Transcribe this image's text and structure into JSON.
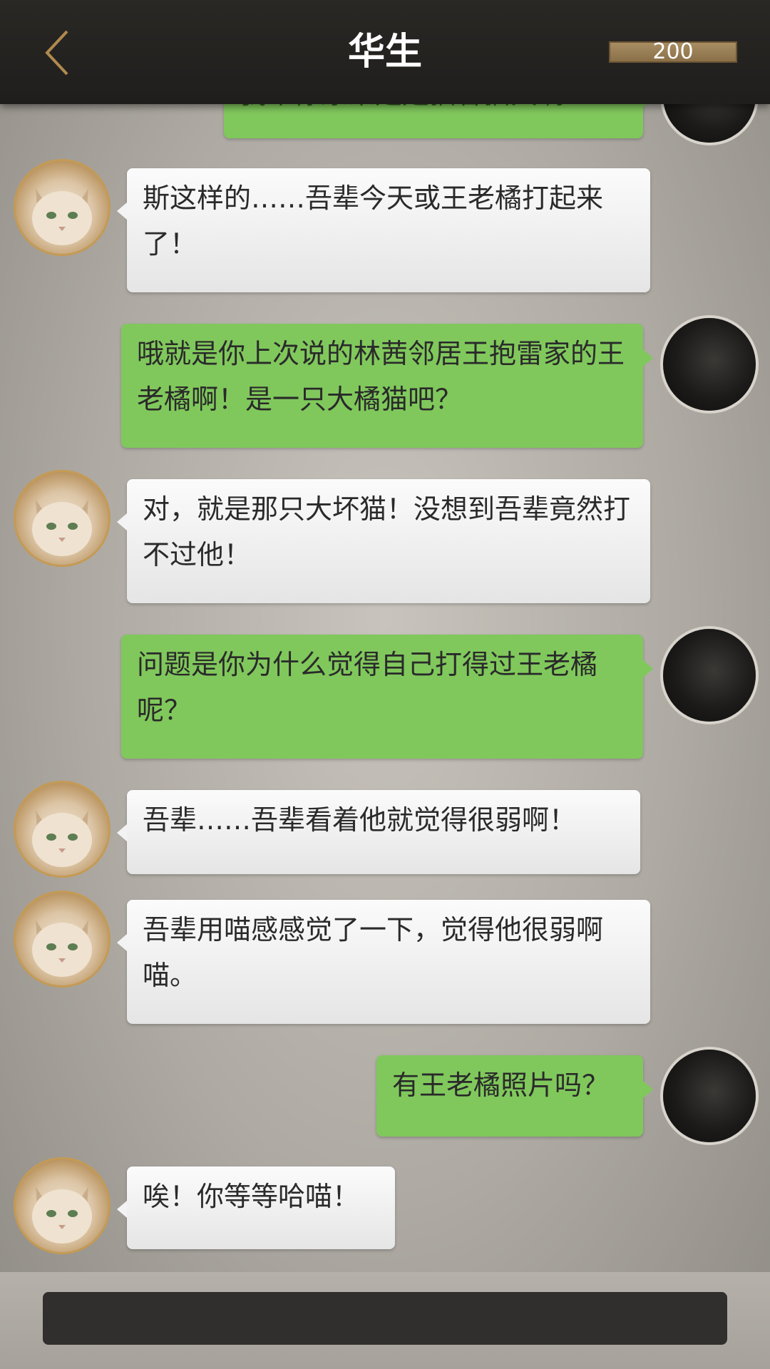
{
  "header": {
    "title": "华生",
    "coins": "200"
  },
  "messages": [
    {
      "side": "right",
      "text": "我辈你原来是是猫谷猫大啊！",
      "partial": true
    },
    {
      "side": "left",
      "text": "斯这样的……吾辈今天或王老橘打起来了！"
    },
    {
      "side": "right",
      "text": "哦就是你上次说的林茜邻居王抱雷家的王老橘啊！是一只大橘猫吧？"
    },
    {
      "side": "left",
      "text": "对，就是那只大坏猫！没想到吾辈竟然打不过他！"
    },
    {
      "side": "right",
      "text": "问题是你为什么觉得自己打得过王老橘呢？"
    },
    {
      "side": "left",
      "text": "吾辈……吾辈看着他就觉得很弱啊！"
    },
    {
      "side": "left",
      "text": "吾辈用喵感感觉了一下，觉得他很弱啊喵。"
    },
    {
      "side": "right",
      "text": "有王老橘照片吗？"
    },
    {
      "side": "left",
      "text": "唉！你等等哈喵！"
    }
  ],
  "input": {
    "value": ""
  },
  "colors": {
    "header_bg": "#222120",
    "outgoing_bubble": "#80c85c",
    "incoming_bubble": "#f0f0f0",
    "coin_bar": "#9a7f56"
  },
  "icons": {
    "back": "chevron-left-icon"
  }
}
